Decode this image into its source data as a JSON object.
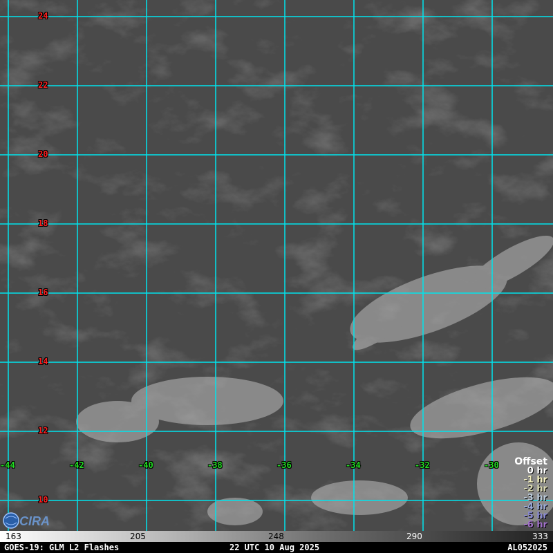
{
  "map": {
    "latitudes": [
      24,
      22,
      20,
      18,
      16,
      14,
      12,
      10
    ],
    "longitudes": [
      -44,
      -42,
      -40,
      -38,
      -36,
      -34,
      -32,
      -30
    ],
    "grid_color": "#00e5ee",
    "lat_label_color": "#ff2020",
    "lon_label_color": "#22dd22"
  },
  "legend": {
    "title": "Offset",
    "entries": [
      {
        "label": "0 hr",
        "color": "#ffffff"
      },
      {
        "label": "-1 hr",
        "color": "#f4f0c0"
      },
      {
        "label": "-2 hr",
        "color": "#d8d8b0"
      },
      {
        "label": "-3 hr",
        "color": "#b8c8d8"
      },
      {
        "label": "-4 hr",
        "color": "#98a8d8"
      },
      {
        "label": "-5 hr",
        "color": "#8888d0"
      },
      {
        "label": "-6 hr",
        "color": "#a070c8"
      }
    ]
  },
  "colorbar": {
    "ticks": [
      "163",
      "205",
      "248",
      "290",
      "333"
    ]
  },
  "footer": {
    "left": "GOES-19: GLM L2 Flashes",
    "center": "22 UTC 10 Aug 2025",
    "right": "AL052025"
  },
  "logo": {
    "icon": "cira-logo",
    "text": "CIRA"
  }
}
